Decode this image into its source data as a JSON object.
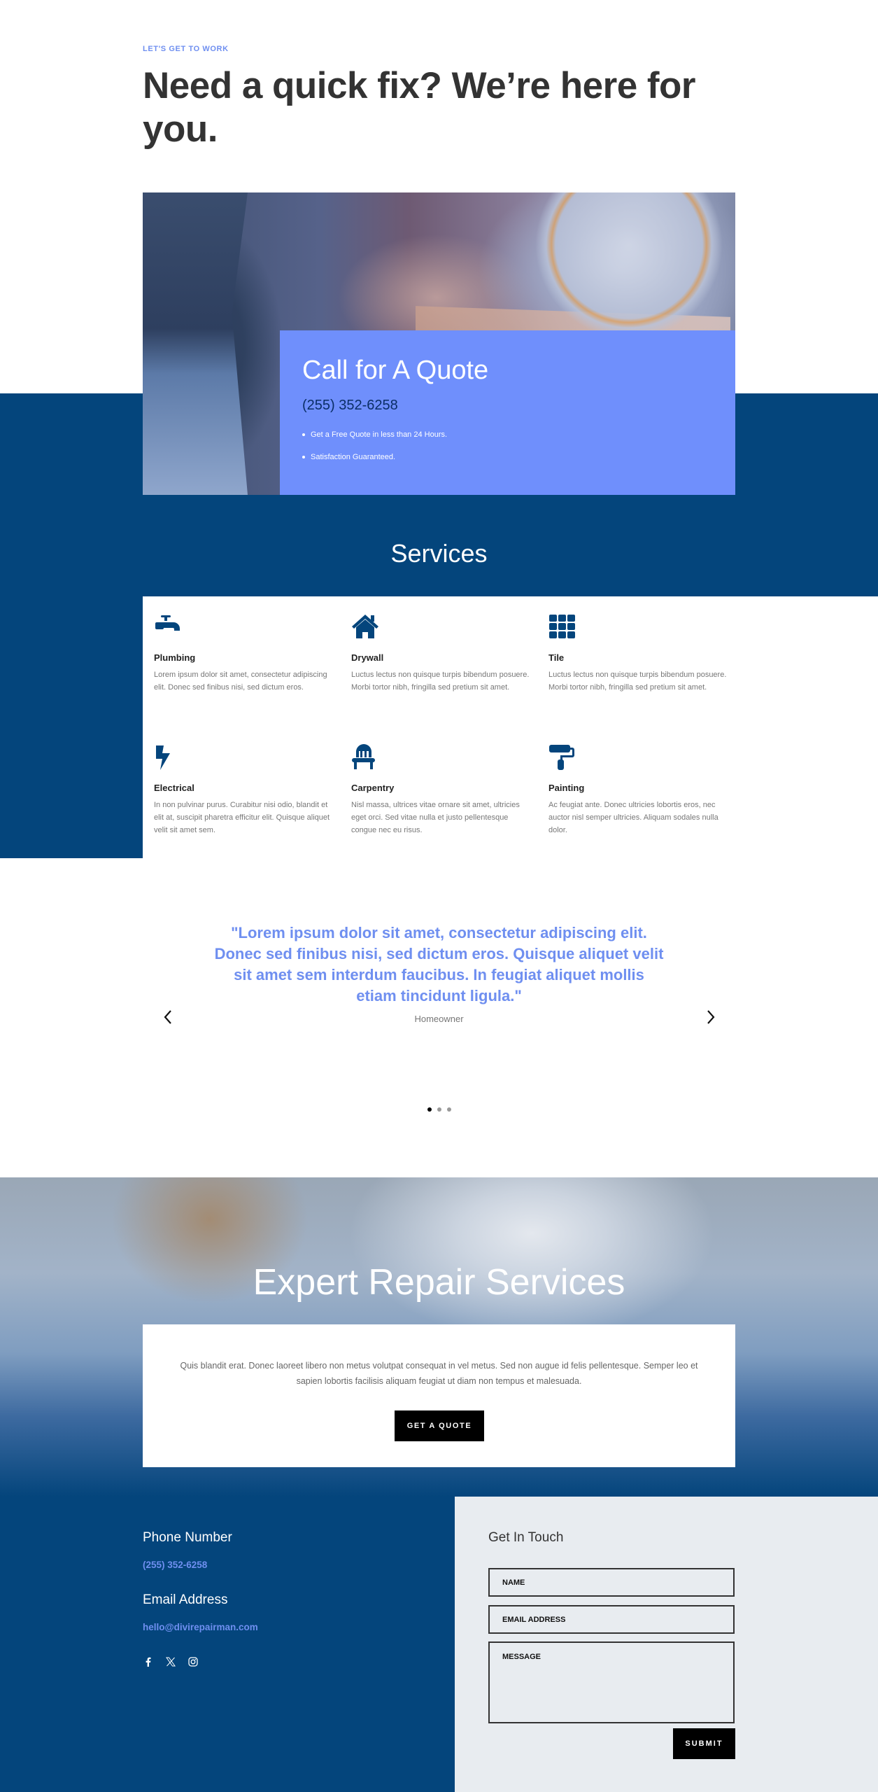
{
  "hero": {
    "eyebrow": "LET'S GET TO WORK",
    "title": "Need a quick fix? We’re here for you."
  },
  "quote_box": {
    "title": "Call for A Quote",
    "phone": "(255) 352-6258",
    "bullets": [
      "Get a Free Quote in less than 24 Hours.",
      "Satisfaction Guaranteed."
    ]
  },
  "services": {
    "title": "Services",
    "items": [
      {
        "icon": "faucet-icon",
        "name": "Plumbing",
        "desc": "Lorem ipsum dolor sit amet, consectetur adipiscing elit. Donec sed finibus nisi, sed dictum eros."
      },
      {
        "icon": "house-icon",
        "name": "Drywall",
        "desc": "Luctus lectus non quisque turpis bibendum posuere. Morbi tortor nibh, fringilla sed pretium sit amet."
      },
      {
        "icon": "tile-grid-icon",
        "name": "Tile",
        "desc": "Luctus lectus non quisque turpis bibendum posuere. Morbi tortor nibh, fringilla sed pretium sit amet."
      },
      {
        "icon": "lightning-bolt-icon",
        "name": "Electrical",
        "desc": "In non pulvinar purus. Curabitur nisi odio, blandit et elit at, suscipit pharetra efficitur elit. Quisque aliquet velit sit amet sem."
      },
      {
        "icon": "chair-icon",
        "name": "Carpentry",
        "desc": "Nisl massa, ultrices vitae ornare sit amet, ultricies eget orci. Sed vitae nulla et justo pellentesque congue nec eu risus."
      },
      {
        "icon": "paint-roller-icon",
        "name": "Painting",
        "desc": "Ac feugiat ante. Donec ultricies lobortis eros, nec auctor nisl semper ultricies. Aliquam sodales nulla dolor."
      }
    ]
  },
  "testimonial": {
    "quote": "\"Lorem ipsum dolor sit amet, consectetur adipiscing elit. Donec sed finibus nisi, sed dictum eros. Quisque aliquet velit sit amet sem interdum faucibus. In feugiat aliquet mollis etiam tincidunt ligula.\"",
    "author": "Homeowner",
    "slide_count": 3,
    "active_slide": 1
  },
  "expert": {
    "title": "Expert Repair Services",
    "text": "Quis blandit erat. Donec laoreet libero non metus volutpat consequat in vel metus. Sed non augue id felis pellentesque. Semper leo et sapien lobortis facilisis aliquam feugiat ut diam non tempus et malesuada.",
    "button": "GET A QUOTE"
  },
  "contact": {
    "phone_heading": "Phone Number",
    "phone": "(255) 352-6258",
    "email_heading": "Email Address",
    "email": "hello@divirepairman.com",
    "social": [
      "facebook-icon",
      "x-twitter-icon",
      "instagram-icon"
    ]
  },
  "form": {
    "title": "Get In Touch",
    "name_placeholder": "NAME",
    "email_placeholder": "EMAIL ADDRESS",
    "message_placeholder": "MESSAGE",
    "submit": "SUBMIT"
  },
  "colors": {
    "navy": "#04457c",
    "accent_blue": "#6f8ffc",
    "link_blue": "#6f8ff0",
    "form_bg": "#e8ecf0"
  }
}
